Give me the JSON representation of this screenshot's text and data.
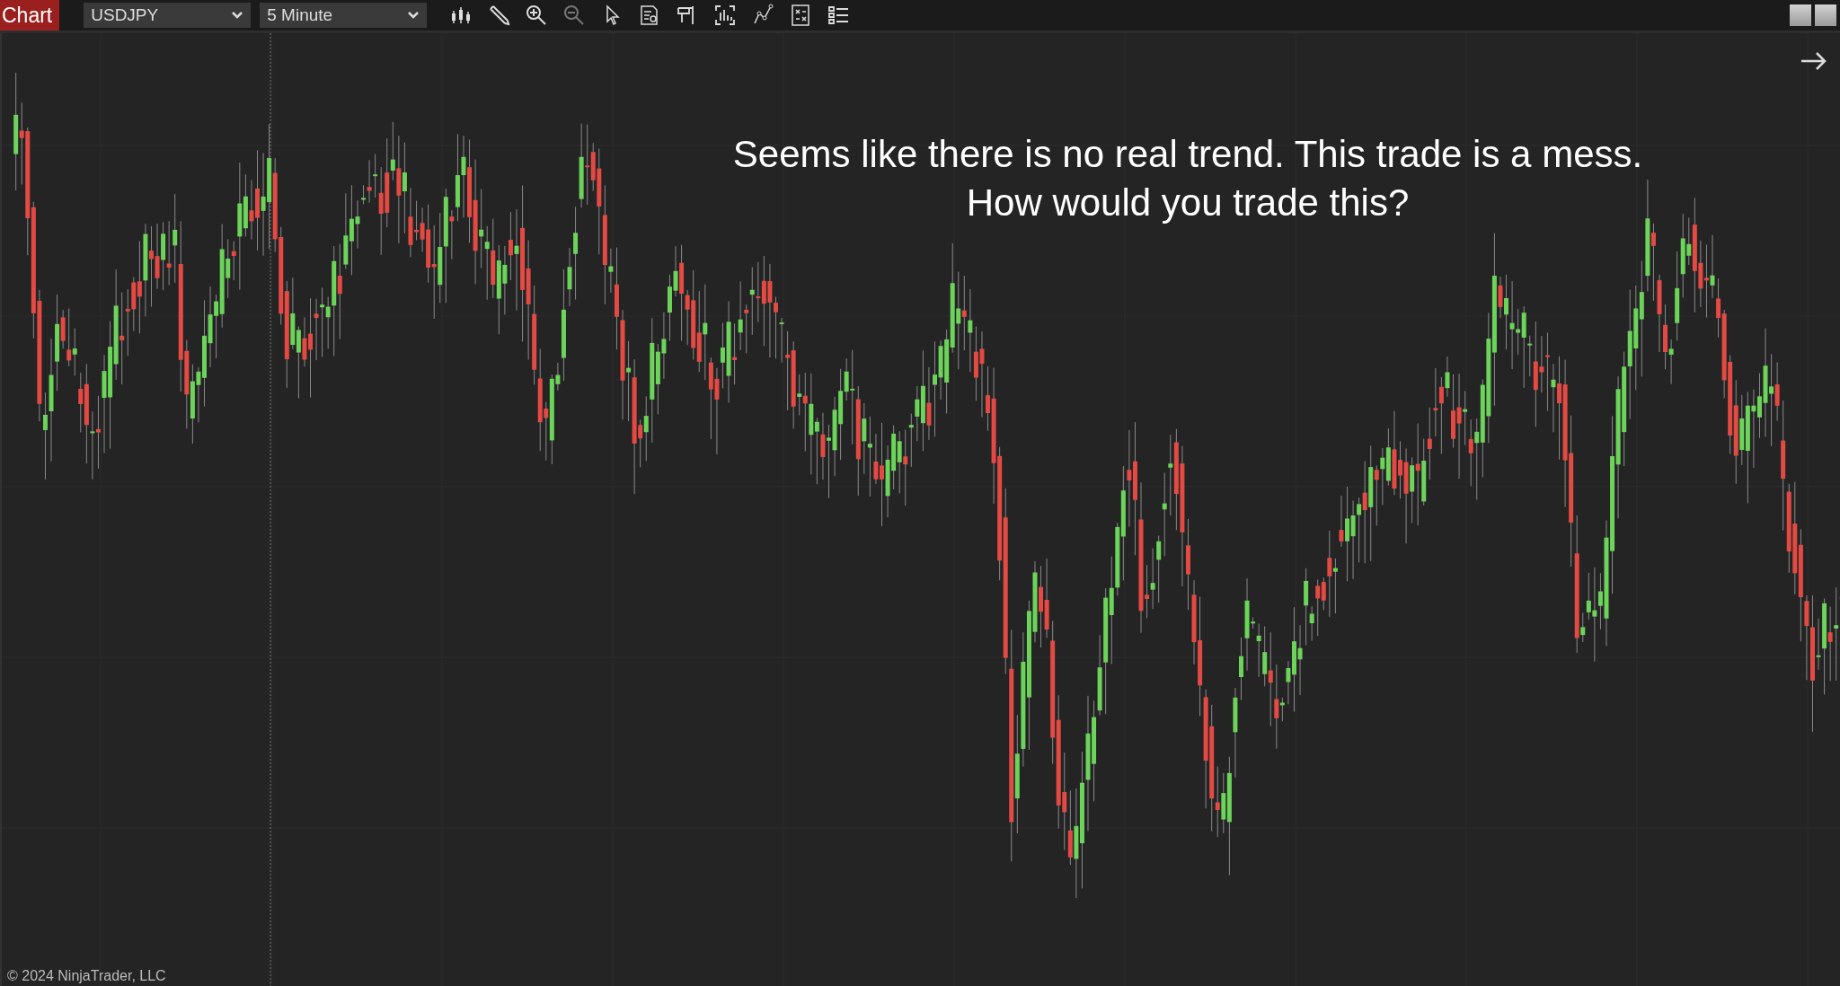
{
  "toolbar": {
    "title": "Chart",
    "instrument": "USDJPY",
    "interval": "5 Minute"
  },
  "chart": {
    "annotation": [
      "Seems like there is no real trend. This trade is a mess.",
      "How would you trade this?"
    ],
    "copyright": "© 2024 NinjaTrader, LLC"
  }
}
